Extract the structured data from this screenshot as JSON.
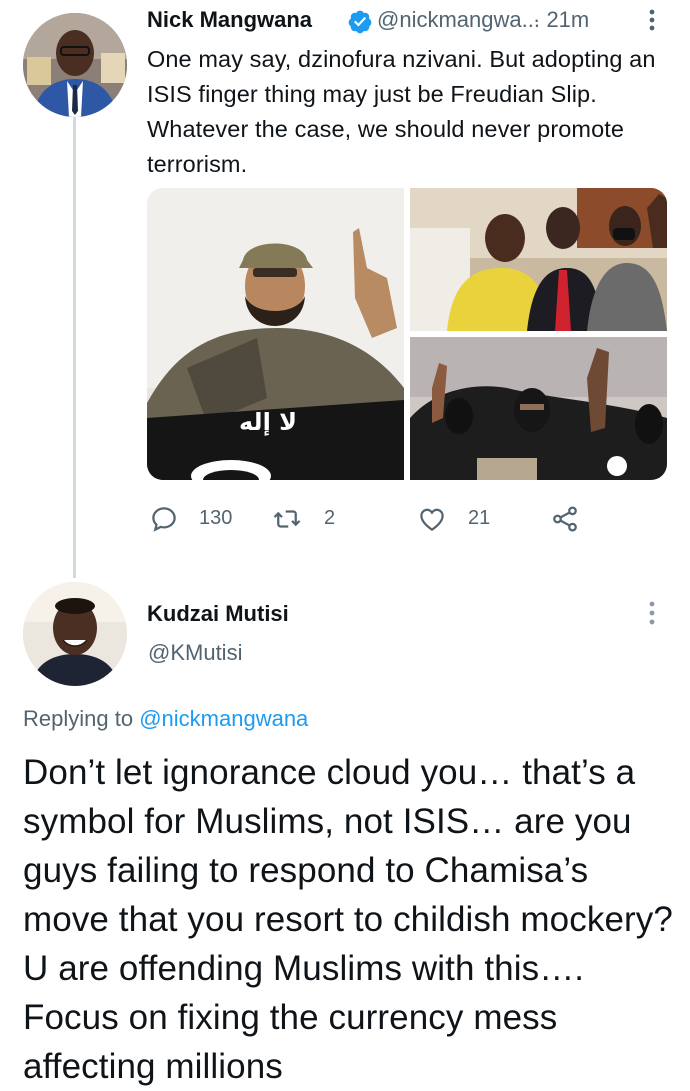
{
  "tweet": {
    "author_name": "Nick Mangwana",
    "handle": "@nickmangwa...",
    "time": "· 21m",
    "text": "One may say, dzinofura nzivani. But adopting an ISIS finger thing may just be Freudian Slip. Whatever the case, we should never promote terrorism.",
    "verified": true,
    "stats": {
      "replies": "130",
      "retweets": "2",
      "likes": "21"
    },
    "media_count": 3
  },
  "reply": {
    "author_name": "Kudzai Mutisi",
    "handle": "@KMutisi",
    "replying_prefix": "Replying to",
    "replying_to": "@nickmangwana",
    "text": "Don’t let ignorance cloud you… that’s a symbol for Muslims, not ISIS… are you guys failing to respond to Chamisa’s move that you resort to childish mockery? U are offending Muslims with this…. Focus on fixing the currency mess affecting millions"
  },
  "icons": [
    "verified-badge-icon",
    "more-options-icon",
    "reply-icon",
    "retweet-icon",
    "like-icon",
    "share-icon"
  ],
  "colors": {
    "accent": "#1d9bf0",
    "secondary_text": "#536471",
    "primary_text": "#0f1419",
    "thread_line": "#cfd9de"
  }
}
